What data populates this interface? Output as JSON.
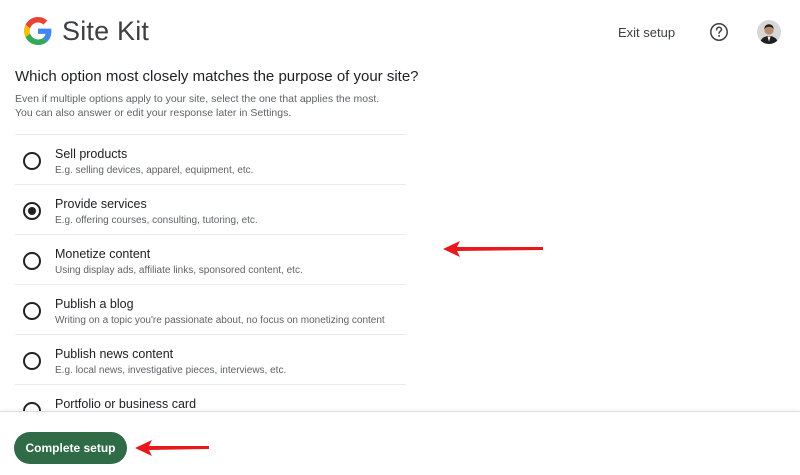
{
  "header": {
    "brand_name": "Site Kit",
    "logo_icon": "google-g-logo",
    "exit_label": "Exit setup",
    "help_icon": "help-circle-icon",
    "avatar_icon": "user-avatar"
  },
  "question": {
    "title": "Which option most closely matches the purpose of your site?",
    "helper_line1": "Even if multiple options apply to your site, select the one that applies the most.",
    "helper_line2": "You can also answer or edit your response later in Settings."
  },
  "options": [
    {
      "label": "Sell products",
      "desc": "E.g. selling devices, apparel, equipment, etc.",
      "selected": false
    },
    {
      "label": "Provide services",
      "desc": "E.g. offering courses, consulting, tutoring, etc.",
      "selected": true
    },
    {
      "label": "Monetize content",
      "desc": "Using display ads, affiliate links, sponsored content, etc.",
      "selected": false
    },
    {
      "label": "Publish a blog",
      "desc": "Writing on a topic you're passionate about, no focus on monetizing content",
      "selected": false
    },
    {
      "label": "Publish news content",
      "desc": "E.g. local news, investigative pieces, interviews, etc.",
      "selected": false
    },
    {
      "label": "Portfolio or business card",
      "desc": "",
      "selected": false
    }
  ],
  "footer": {
    "complete_label": "Complete setup"
  },
  "colors": {
    "button_bg": "#2e6b46",
    "arrow": "#e8191c",
    "text_primary": "#202124",
    "text_secondary": "#5f6368"
  }
}
